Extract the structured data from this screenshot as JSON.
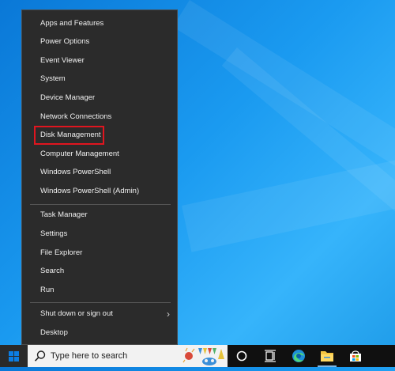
{
  "menu": {
    "items": [
      {
        "label": "Apps and Features",
        "name": "menu-item-apps-and-features"
      },
      {
        "label": "Power Options",
        "name": "menu-item-power-options"
      },
      {
        "label": "Event Viewer",
        "name": "menu-item-event-viewer"
      },
      {
        "label": "System",
        "name": "menu-item-system"
      },
      {
        "label": "Device Manager",
        "name": "menu-item-device-manager"
      },
      {
        "label": "Network Connections",
        "name": "menu-item-network-connections"
      },
      {
        "label": "Disk Management",
        "name": "menu-item-disk-management"
      },
      {
        "label": "Computer Management",
        "name": "menu-item-computer-management"
      },
      {
        "label": "Windows PowerShell",
        "name": "menu-item-windows-powershell"
      },
      {
        "label": "Windows PowerShell (Admin)",
        "name": "menu-item-windows-powershell-admin"
      },
      {
        "label": "Task Manager",
        "name": "menu-item-task-manager"
      },
      {
        "label": "Settings",
        "name": "menu-item-settings"
      },
      {
        "label": "File Explorer",
        "name": "menu-item-file-explorer"
      },
      {
        "label": "Search",
        "name": "menu-item-search"
      },
      {
        "label": "Run",
        "name": "menu-item-run"
      },
      {
        "label": "Shut down or sign out",
        "name": "menu-item-shut-down-or-sign-out"
      },
      {
        "label": "Desktop",
        "name": "menu-item-desktop"
      }
    ],
    "highlighted_item": "Disk Management",
    "highlight_color": "#e0151f"
  },
  "taskbar": {
    "search_placeholder": "Type here to search",
    "icons": [
      "windows-start-icon",
      "search-icon",
      "cortana-icon",
      "task-view-icon",
      "edge-icon",
      "file-explorer-icon",
      "store-icon"
    ],
    "accent_color": "#0c7de3"
  }
}
